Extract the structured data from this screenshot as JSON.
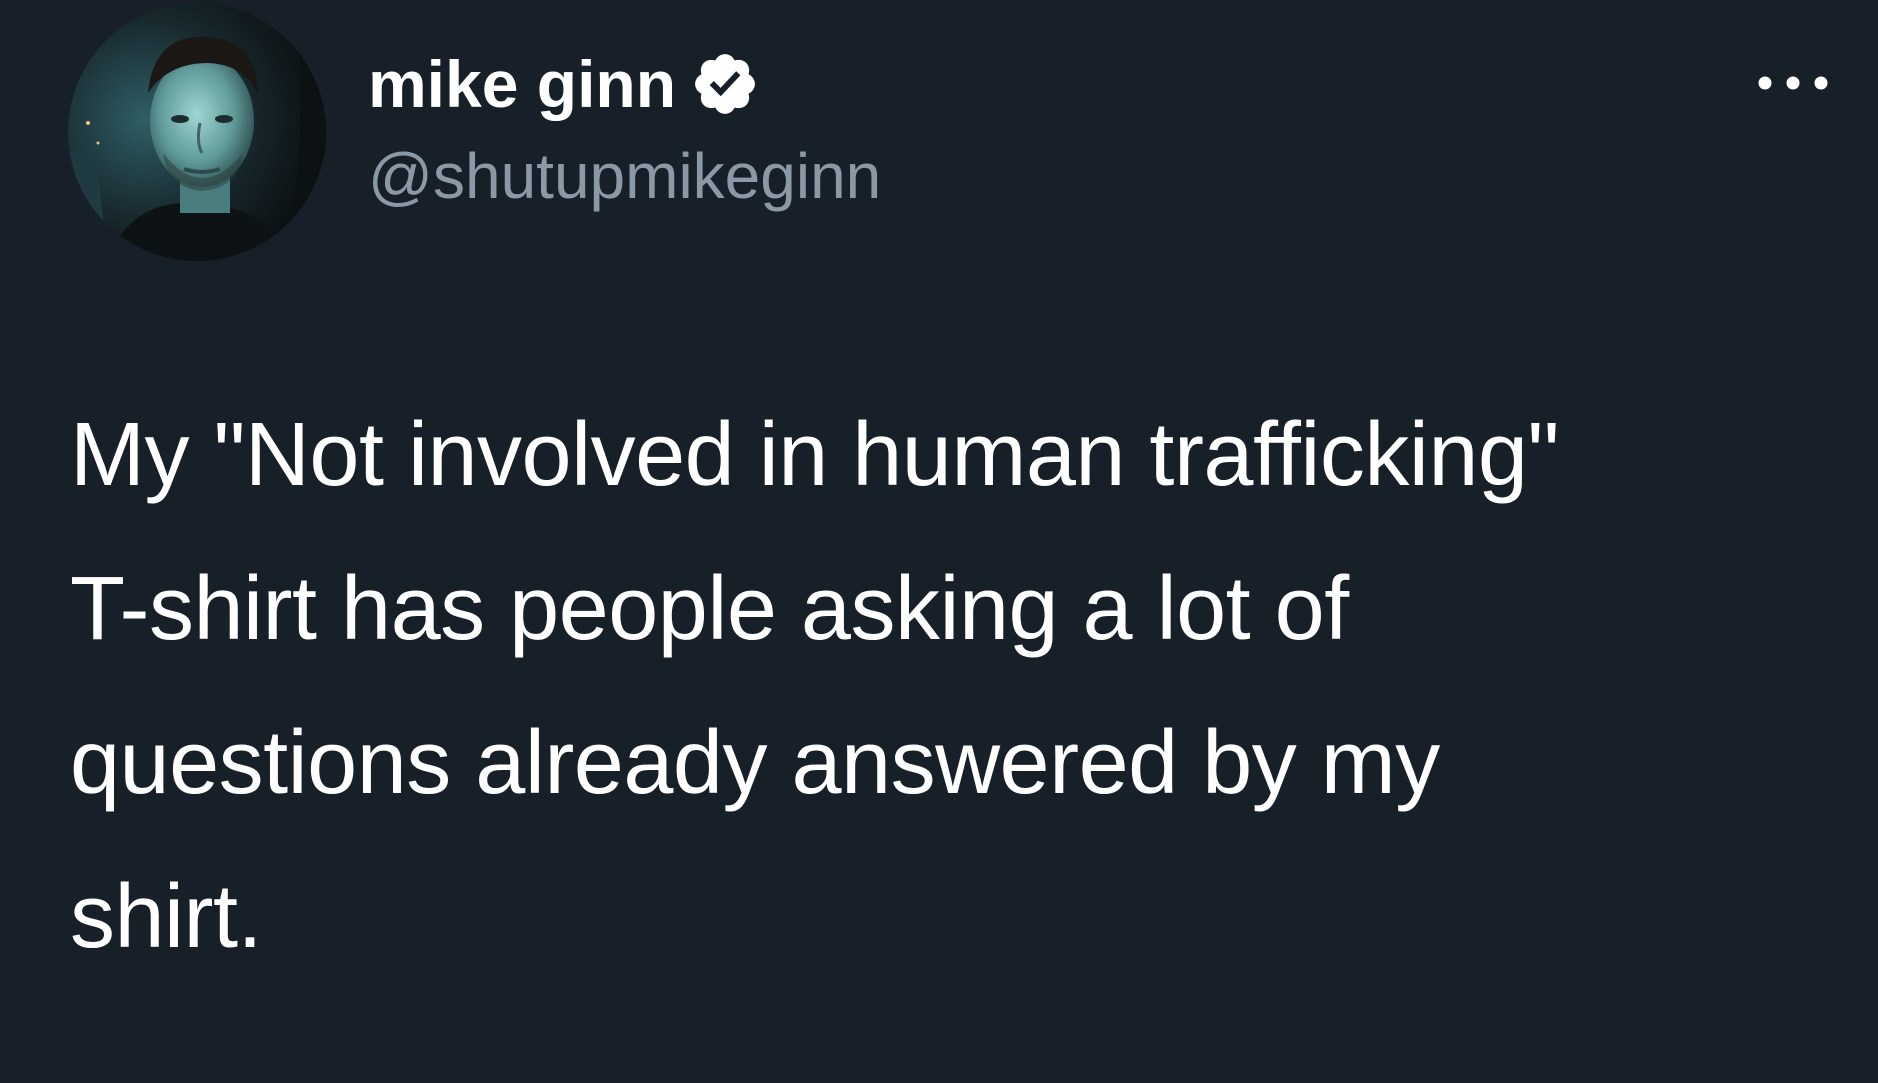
{
  "author": {
    "display_name": "mike ginn",
    "handle": "@shutupmikeginn",
    "verified": true,
    "avatar_icon": "profile-photo"
  },
  "tweet": {
    "lines": [
      "My \"Not involved in human trafficking\"",
      "T-shirt has people asking a lot of",
      "questions already answered by my",
      "shirt."
    ]
  },
  "icons": {
    "verified": "verified-badge-icon",
    "more": "more-options-icon"
  },
  "colors": {
    "background": "#172029",
    "text": "#ffffff",
    "secondary_text": "#8b98a5"
  }
}
